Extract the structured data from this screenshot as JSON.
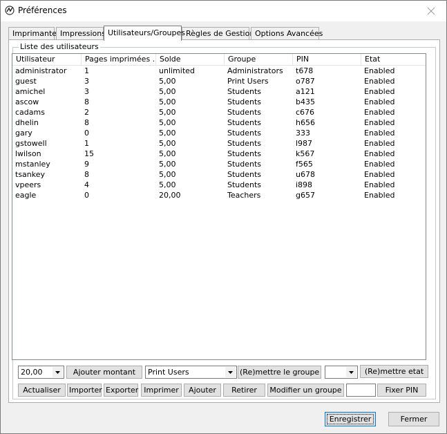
{
  "window": {
    "title": "Préférences"
  },
  "tabs": [
    {
      "label": "Imprimantes"
    },
    {
      "label": "Impressions"
    },
    {
      "label": "Utilisateurs/Groupes"
    },
    {
      "label": "Règles de Gestion"
    },
    {
      "label": "Options Avancées"
    }
  ],
  "users_group": {
    "label": "Liste des utilisateurs"
  },
  "columns": [
    "Utilisateur",
    "Pages imprimées ...",
    "Solde",
    "Groupe",
    "PIN",
    "Etat"
  ],
  "rows": [
    [
      "administrator",
      "1",
      "unlimited",
      "Administrators",
      "t678",
      "Enabled"
    ],
    [
      "guest",
      "3",
      "5,00",
      "Print Users",
      "o787",
      "Enabled"
    ],
    [
      "amichel",
      "3",
      "5,00",
      "Students",
      "a121",
      "Enabled"
    ],
    [
      "ascow",
      "8",
      "5,00",
      "Students",
      "b435",
      "Enabled"
    ],
    [
      "cadams",
      "2",
      "5,00",
      "Students",
      "c676",
      "Enabled"
    ],
    [
      "dhelin",
      "8",
      "5,00",
      "Students",
      "h656",
      "Enabled"
    ],
    [
      "gary",
      "0",
      "5,00",
      "Students",
      "333",
      "Enabled"
    ],
    [
      "gstowell",
      "1",
      "5,00",
      "Students",
      "l987",
      "Enabled"
    ],
    [
      "lwilson",
      "15",
      "5,00",
      "Students",
      "k567",
      "Enabled"
    ],
    [
      "mstanley",
      "9",
      "5,00",
      "Students",
      "f565",
      "Enabled"
    ],
    [
      "tsankey",
      "8",
      "5,00",
      "Students",
      "u678",
      "Enabled"
    ],
    [
      "vpeers",
      "4",
      "5,00",
      "Students",
      "i898",
      "Enabled"
    ],
    [
      "eagle",
      "0",
      "20,00",
      "Teachers",
      "g657",
      "Enabled"
    ]
  ],
  "controls": {
    "amount_value": "20,00",
    "add_amount": "Ajouter montant",
    "group_value": "Print Users",
    "set_group": "(Re)mettre le groupe",
    "state_value": "",
    "set_state": "(Re)mettre etat",
    "refresh": "Actualiser",
    "import": "Importer",
    "export": "Exporter",
    "print": "Imprimer",
    "add": "Ajouter",
    "remove": "Retirer",
    "modify_group": "Modifier un groupe",
    "pin_value": "",
    "set_pin": "Fixer PIN"
  },
  "footer": {
    "save": "Enregistrer",
    "close": "Fermer"
  }
}
